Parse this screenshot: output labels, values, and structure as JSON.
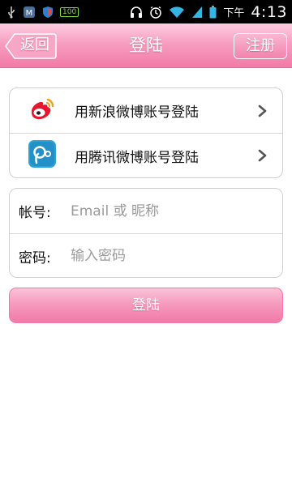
{
  "status_bar": {
    "time_label": "下午",
    "time": "4:13",
    "battery_tag": "100",
    "icons": [
      "usb-icon",
      "notification-icon",
      "shield-icon",
      "battery-tag-icon",
      "headphones-icon",
      "alarm-icon",
      "wifi-icon",
      "signal-icon",
      "battery-icon"
    ]
  },
  "header": {
    "title": "登陆",
    "back_label": "返回",
    "register_label": "注册",
    "color": "#f48fb6"
  },
  "social_login": [
    {
      "label": "用新浪微博账号登陆",
      "icon": "sina-weibo-icon"
    },
    {
      "label": "用腾讯微博账号登陆",
      "icon": "tencent-weibo-icon"
    }
  ],
  "form": {
    "account_label": "帐号:",
    "account_placeholder": "Email 或 昵称",
    "password_label": "密码:",
    "password_placeholder": "输入密码"
  },
  "login_button": {
    "label": "登陆",
    "color": "#f48fb6"
  }
}
